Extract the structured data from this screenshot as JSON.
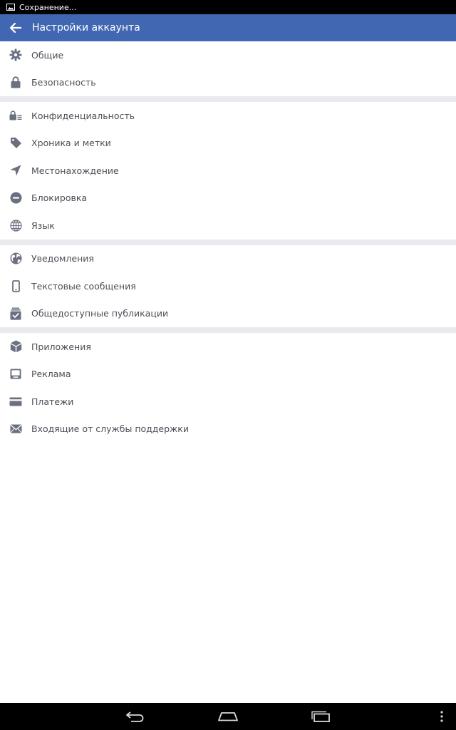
{
  "status_bar": {
    "text": "Сохранение...",
    "icon": "image-icon"
  },
  "app_bar": {
    "title": "Настройки аккаунта",
    "back_icon": "arrow-left-icon",
    "color": "#4267b2"
  },
  "sections": [
    {
      "items": [
        {
          "label": "Общие",
          "icon": "gear-icon"
        },
        {
          "label": "Безопасность",
          "icon": "lock-icon"
        }
      ]
    },
    {
      "items": [
        {
          "label": "Конфиденциальность",
          "icon": "privacy-lock-icon"
        },
        {
          "label": "Хроника и метки",
          "icon": "tag-icon"
        },
        {
          "label": "Местонахождение",
          "icon": "location-arrow-icon"
        },
        {
          "label": "Блокировка",
          "icon": "block-icon"
        },
        {
          "label": "Язык",
          "icon": "globe-icon"
        }
      ]
    },
    {
      "items": [
        {
          "label": "Уведомления",
          "icon": "notifications-globe-icon"
        },
        {
          "label": "Текстовые сообщения",
          "icon": "phone-icon"
        },
        {
          "label": "Общедоступные публикации",
          "icon": "public-posts-icon"
        }
      ]
    },
    {
      "items": [
        {
          "label": "Приложения",
          "icon": "cube-icon"
        },
        {
          "label": "Реклама",
          "icon": "ads-icon"
        },
        {
          "label": "Платежи",
          "icon": "card-icon"
        },
        {
          "label": "Входящие от службы поддержки",
          "icon": "envelope-icon"
        }
      ]
    }
  ],
  "nav_bar": {
    "back": "nav-back-icon",
    "home": "nav-home-icon",
    "recents": "nav-recents-icon",
    "menu": "nav-menu-icon"
  }
}
